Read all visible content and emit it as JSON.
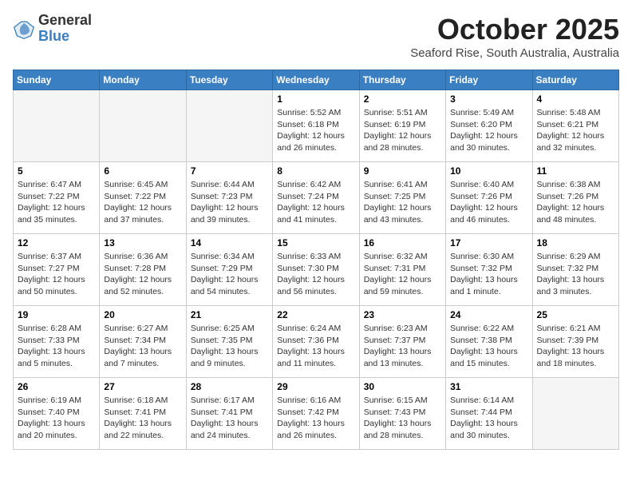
{
  "header": {
    "logo": {
      "general": "General",
      "blue": "Blue"
    },
    "title": "October 2025",
    "subtitle": "Seaford Rise, South Australia, Australia"
  },
  "weekdays": [
    "Sunday",
    "Monday",
    "Tuesday",
    "Wednesday",
    "Thursday",
    "Friday",
    "Saturday"
  ],
  "weeks": [
    [
      {
        "day": "",
        "info": ""
      },
      {
        "day": "",
        "info": ""
      },
      {
        "day": "",
        "info": ""
      },
      {
        "day": "1",
        "info": "Sunrise: 5:52 AM\nSunset: 6:18 PM\nDaylight: 12 hours\nand 26 minutes."
      },
      {
        "day": "2",
        "info": "Sunrise: 5:51 AM\nSunset: 6:19 PM\nDaylight: 12 hours\nand 28 minutes."
      },
      {
        "day": "3",
        "info": "Sunrise: 5:49 AM\nSunset: 6:20 PM\nDaylight: 12 hours\nand 30 minutes."
      },
      {
        "day": "4",
        "info": "Sunrise: 5:48 AM\nSunset: 6:21 PM\nDaylight: 12 hours\nand 32 minutes."
      }
    ],
    [
      {
        "day": "5",
        "info": "Sunrise: 6:47 AM\nSunset: 7:22 PM\nDaylight: 12 hours\nand 35 minutes."
      },
      {
        "day": "6",
        "info": "Sunrise: 6:45 AM\nSunset: 7:22 PM\nDaylight: 12 hours\nand 37 minutes."
      },
      {
        "day": "7",
        "info": "Sunrise: 6:44 AM\nSunset: 7:23 PM\nDaylight: 12 hours\nand 39 minutes."
      },
      {
        "day": "8",
        "info": "Sunrise: 6:42 AM\nSunset: 7:24 PM\nDaylight: 12 hours\nand 41 minutes."
      },
      {
        "day": "9",
        "info": "Sunrise: 6:41 AM\nSunset: 7:25 PM\nDaylight: 12 hours\nand 43 minutes."
      },
      {
        "day": "10",
        "info": "Sunrise: 6:40 AM\nSunset: 7:26 PM\nDaylight: 12 hours\nand 46 minutes."
      },
      {
        "day": "11",
        "info": "Sunrise: 6:38 AM\nSunset: 7:26 PM\nDaylight: 12 hours\nand 48 minutes."
      }
    ],
    [
      {
        "day": "12",
        "info": "Sunrise: 6:37 AM\nSunset: 7:27 PM\nDaylight: 12 hours\nand 50 minutes."
      },
      {
        "day": "13",
        "info": "Sunrise: 6:36 AM\nSunset: 7:28 PM\nDaylight: 12 hours\nand 52 minutes."
      },
      {
        "day": "14",
        "info": "Sunrise: 6:34 AM\nSunset: 7:29 PM\nDaylight: 12 hours\nand 54 minutes."
      },
      {
        "day": "15",
        "info": "Sunrise: 6:33 AM\nSunset: 7:30 PM\nDaylight: 12 hours\nand 56 minutes."
      },
      {
        "day": "16",
        "info": "Sunrise: 6:32 AM\nSunset: 7:31 PM\nDaylight: 12 hours\nand 59 minutes."
      },
      {
        "day": "17",
        "info": "Sunrise: 6:30 AM\nSunset: 7:32 PM\nDaylight: 13 hours\nand 1 minute."
      },
      {
        "day": "18",
        "info": "Sunrise: 6:29 AM\nSunset: 7:32 PM\nDaylight: 13 hours\nand 3 minutes."
      }
    ],
    [
      {
        "day": "19",
        "info": "Sunrise: 6:28 AM\nSunset: 7:33 PM\nDaylight: 13 hours\nand 5 minutes."
      },
      {
        "day": "20",
        "info": "Sunrise: 6:27 AM\nSunset: 7:34 PM\nDaylight: 13 hours\nand 7 minutes."
      },
      {
        "day": "21",
        "info": "Sunrise: 6:25 AM\nSunset: 7:35 PM\nDaylight: 13 hours\nand 9 minutes."
      },
      {
        "day": "22",
        "info": "Sunrise: 6:24 AM\nSunset: 7:36 PM\nDaylight: 13 hours\nand 11 minutes."
      },
      {
        "day": "23",
        "info": "Sunrise: 6:23 AM\nSunset: 7:37 PM\nDaylight: 13 hours\nand 13 minutes."
      },
      {
        "day": "24",
        "info": "Sunrise: 6:22 AM\nSunset: 7:38 PM\nDaylight: 13 hours\nand 15 minutes."
      },
      {
        "day": "25",
        "info": "Sunrise: 6:21 AM\nSunset: 7:39 PM\nDaylight: 13 hours\nand 18 minutes."
      }
    ],
    [
      {
        "day": "26",
        "info": "Sunrise: 6:19 AM\nSunset: 7:40 PM\nDaylight: 13 hours\nand 20 minutes."
      },
      {
        "day": "27",
        "info": "Sunrise: 6:18 AM\nSunset: 7:41 PM\nDaylight: 13 hours\nand 22 minutes."
      },
      {
        "day": "28",
        "info": "Sunrise: 6:17 AM\nSunset: 7:41 PM\nDaylight: 13 hours\nand 24 minutes."
      },
      {
        "day": "29",
        "info": "Sunrise: 6:16 AM\nSunset: 7:42 PM\nDaylight: 13 hours\nand 26 minutes."
      },
      {
        "day": "30",
        "info": "Sunrise: 6:15 AM\nSunset: 7:43 PM\nDaylight: 13 hours\nand 28 minutes."
      },
      {
        "day": "31",
        "info": "Sunrise: 6:14 AM\nSunset: 7:44 PM\nDaylight: 13 hours\nand 30 minutes."
      },
      {
        "day": "",
        "info": ""
      }
    ]
  ]
}
